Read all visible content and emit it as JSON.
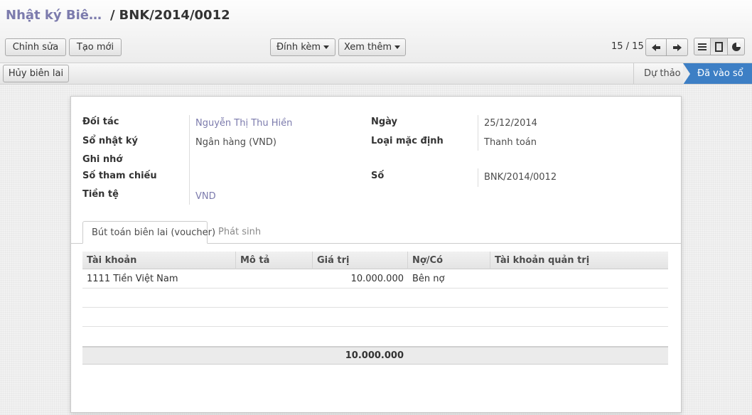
{
  "breadcrumb": {
    "parent": "Nhật ký Biê…",
    "separator": "/",
    "current": "BNK/2014/0012"
  },
  "toolbar": {
    "edit_label": "Chỉnh sửa",
    "create_label": "Tạo mới",
    "attach_label": "Đính kèm",
    "more_label": "Xem thêm"
  },
  "pager": {
    "text": "15 / 15"
  },
  "actions": {
    "cancel_label": "Hủy biên lai"
  },
  "status": {
    "steps": [
      "Dự thảo",
      "Đã vào sổ"
    ],
    "active": "Đã vào sổ"
  },
  "form": {
    "left": [
      {
        "label": "Đối tác",
        "value": "Nguyễn Thị Thu Hiền"
      },
      {
        "label": "Sổ nhật ký",
        "value": "Ngân hàng (VND)"
      },
      {
        "label": "Ghi nhớ",
        "value": ""
      },
      {
        "label": "Số tham chiếu",
        "value": ""
      },
      {
        "label": "Tiền tệ",
        "value": "VND"
      }
    ],
    "right": [
      {
        "label": "Ngày",
        "value": "25/12/2014"
      },
      {
        "label": "Loại mặc định",
        "value": "Thanh toán"
      },
      {
        "label": "Số",
        "value": "BNK/2014/0012"
      }
    ]
  },
  "tabs": [
    {
      "label": "Bút toán biên lai (voucher)"
    },
    {
      "label": "Phát sinh"
    }
  ],
  "grid": {
    "columns": [
      "Tài khoản",
      "Mô tả",
      "Giá trị",
      "Nợ/Có",
      "Tài khoản quản trị"
    ],
    "rows": [
      {
        "account": "1111 Tiền Việt Nam",
        "description": "",
        "amount": "10.000.000",
        "type": "Bên nợ",
        "analytic": ""
      }
    ],
    "total": "10.000.000"
  },
  "colors": {
    "link": "#7c7bad",
    "status_active": "#3d7fc5"
  }
}
